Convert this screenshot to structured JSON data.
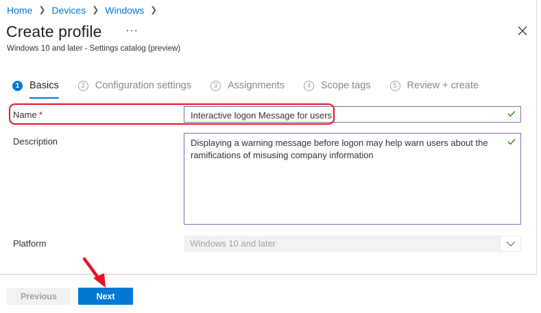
{
  "breadcrumb": [
    {
      "label": "Home"
    },
    {
      "label": "Devices"
    },
    {
      "label": "Windows"
    }
  ],
  "header": {
    "title": "Create profile",
    "more_label": "···",
    "subtitle": "Windows 10 and later - Settings catalog (preview)"
  },
  "wizard": {
    "steps": [
      {
        "num": "1",
        "label": "Basics",
        "active": true
      },
      {
        "num": "2",
        "label": "Configuration settings",
        "active": false
      },
      {
        "num": "3",
        "label": "Assignments",
        "active": false
      },
      {
        "num": "4",
        "label": "Scope tags",
        "active": false
      },
      {
        "num": "5",
        "label": "Review + create",
        "active": false
      }
    ]
  },
  "form": {
    "name_label": "Name",
    "required_marker": "*",
    "name_value": "Interactive logon Message for users",
    "description_label": "Description",
    "description_value": "Displaying a warning message before logon may help warn users about the ramifications of misusing company information",
    "platform_label": "Platform",
    "platform_value": "Windows 10 and later"
  },
  "footer": {
    "previous_label": "Previous",
    "next_label": "Next"
  },
  "colors": {
    "accent": "#0078d4",
    "input_border": "#8764b8",
    "valid_check": "#107c10",
    "annotation_red": "#e81123"
  },
  "icons": {
    "close": "close-icon",
    "check": "checkmark-icon",
    "chevron": "chevron-down-icon",
    "breadcrumb_separator": "chevron-right-icon",
    "annotation": "red-arrow-annotation"
  }
}
